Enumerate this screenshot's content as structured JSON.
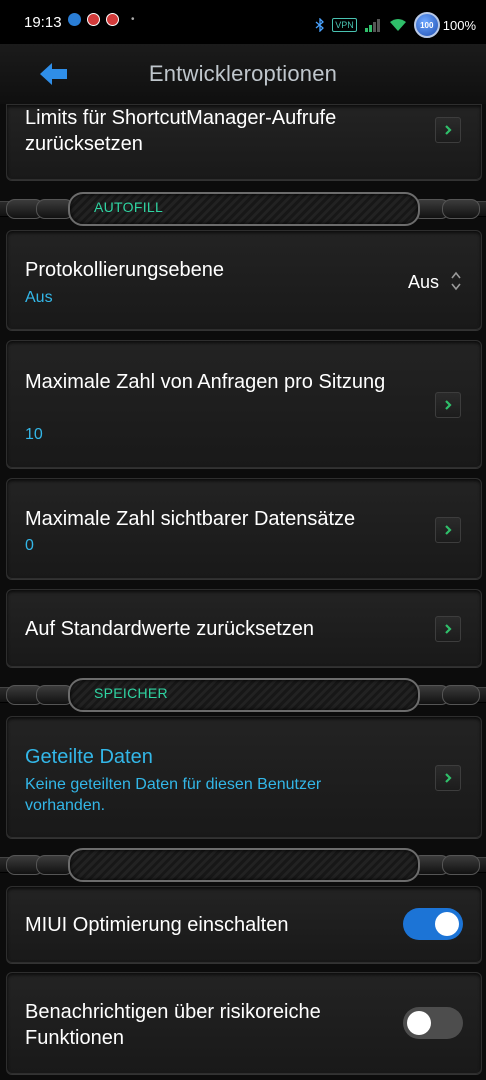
{
  "status_bar": {
    "time": "19:13",
    "vpn": "VPN",
    "battery_badge": "100",
    "battery_percent": "100%"
  },
  "header": {
    "title": "Entwickleroptionen"
  },
  "items": {
    "shortcut_reset": {
      "title": "Limits für ShortcutManager-Aufrufe zurücksetzen"
    },
    "logging_level": {
      "title": "Protokollierungsebene",
      "subtitle": "Aus",
      "value": "Aus"
    },
    "max_requests": {
      "title": "Maximale Zahl von Anfragen pro Sitzung",
      "subtitle": "10"
    },
    "max_datasets": {
      "title": "Maximale Zahl sichtbarer Datensätze",
      "subtitle": "0"
    },
    "reset_defaults": {
      "title": "Auf Standardwerte zurücksetzen"
    },
    "shared_data": {
      "title": "Geteilte Daten",
      "subtitle": "Keine geteilten Daten für diesen Benutzer vorhanden."
    },
    "miui_optimization": {
      "title": "MIUI Optimierung einschalten",
      "enabled": true
    },
    "risky_functions": {
      "title": "Benachrichtigen über risikoreiche Funktionen",
      "enabled": false
    }
  },
  "sections": {
    "autofill": "AUTOFILL",
    "storage": "SPEICHER",
    "third": ""
  },
  "colors": {
    "accent_blue": "#33b7e8",
    "section_green": "#2fd4a2",
    "toggle_on": "#1c74d6",
    "chevron_green": "#2fbf6a"
  },
  "icons": {
    "back": "back-arrow-icon",
    "chevron": "chevron-right-icon",
    "updown": "up-down-chevron-icon"
  }
}
